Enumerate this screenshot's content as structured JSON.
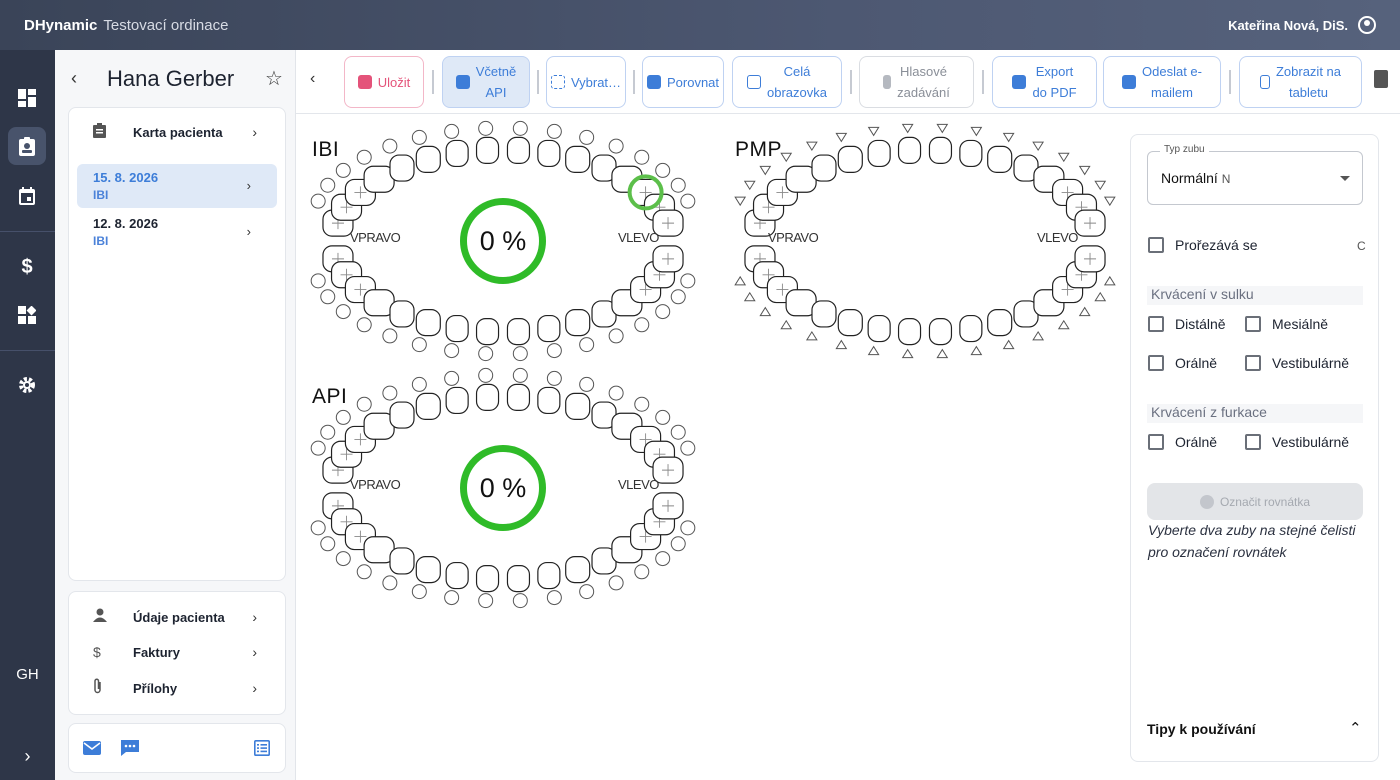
{
  "app": {
    "brand": "DHynamic",
    "clinic": "Testovací ordinace",
    "user": "Kateřina Nová, DiS."
  },
  "rail": {
    "items": [
      {
        "icon": "dashboard-icon"
      },
      {
        "icon": "patient-card-icon"
      },
      {
        "icon": "calendar-icon"
      },
      {
        "icon": "dollar-icon"
      },
      {
        "icon": "widgets-icon"
      },
      {
        "icon": "gear-icon"
      }
    ],
    "initials": "GH",
    "expand": "›"
  },
  "patient": {
    "name": "Hana Gerber",
    "card_label": "Karta pacienta",
    "visits": [
      {
        "date": "15. 8. 2026",
        "type": "IBI"
      },
      {
        "date": "12. 8. 2026",
        "type": "IBI"
      }
    ],
    "links": [
      {
        "label": "Údaje pacienta"
      },
      {
        "label": "Faktury"
      },
      {
        "label": "Přílohy"
      }
    ]
  },
  "toolbar": {
    "save": "Uložit",
    "include_api_1": "Včetně",
    "include_api_2": "API",
    "select": "Vybrat…",
    "compare": "Porovnat",
    "full_1": "Celá",
    "full_2": "obrazovka",
    "voice_1": "Hlasové",
    "voice_2": "zadávání",
    "export_1": "Export",
    "export_2": "do PDF",
    "email_1": "Odeslat e-",
    "email_2": "mailem",
    "tablet_1": "Zobrazit na",
    "tablet_2": "tabletu"
  },
  "charts": {
    "ibi": {
      "title": "IBI",
      "value": "0 %",
      "right": "VPRAVO",
      "left": "VLEVO"
    },
    "pmp": {
      "title": "PMP",
      "right": "VPRAVO",
      "left": "VLEVO"
    },
    "api": {
      "title": "API",
      "value": "0 %",
      "right": "VPRAVO",
      "left": "VLEVO"
    }
  },
  "right_panel": {
    "tooth_type_label": "Typ zubu",
    "tooth_type_value": "Normální",
    "tooth_type_code": "N",
    "erupting": "Prořezává se",
    "erupting_cut": "C",
    "sulcus_title": "Krvácení v sulku",
    "distal": "Distálně",
    "mesial": "Mesiálně",
    "oral": "Orálně",
    "vestibular": "Vestibulárně",
    "furcation_title": "Krvácení z furkace",
    "furc_oral": "Orálně",
    "furc_vestibular": "Vestibulárně",
    "mark_button": "Označit rovnátka",
    "hint": "Vyberte dva zuby na stejné čelisti pro označení rovnátek",
    "tips": "Tipy k používání"
  },
  "colors": {
    "accent": "#3d7dd8",
    "save": "#e4537a",
    "ring": "#2fbb28",
    "highlight": "#5cbf4a"
  }
}
